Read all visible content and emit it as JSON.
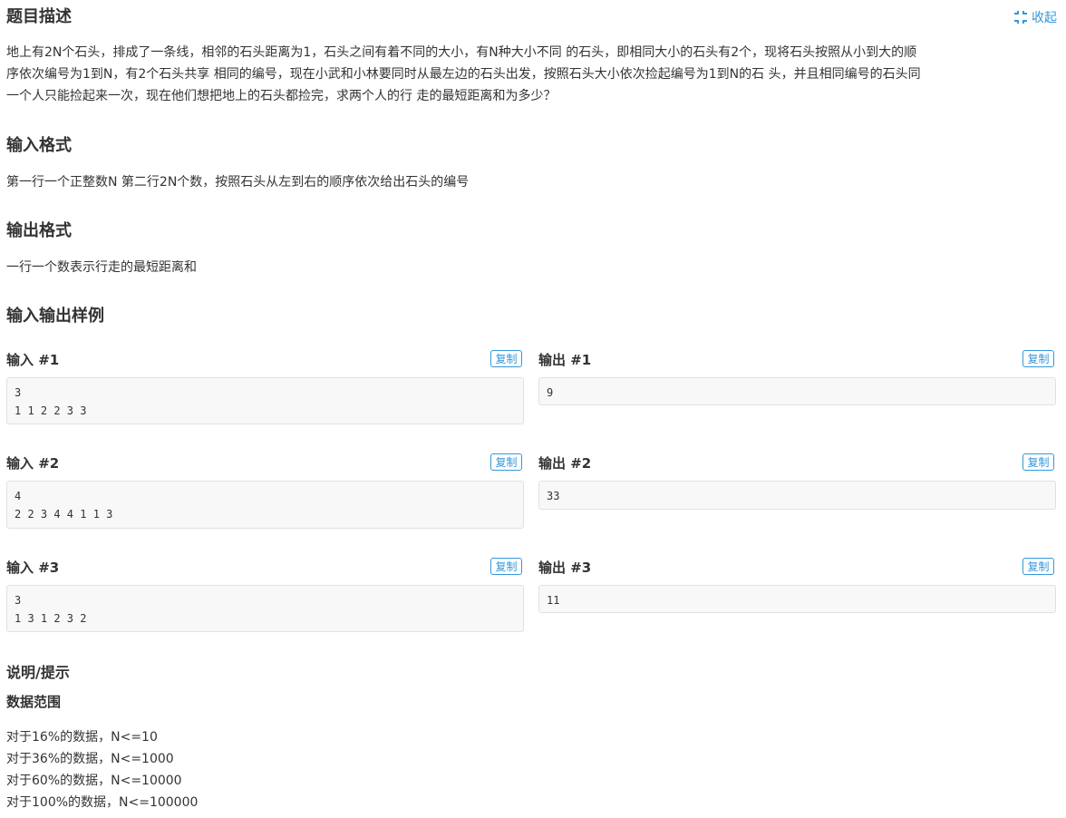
{
  "description": {
    "title": "题目描述",
    "collapse_label": "收起",
    "text": "地上有2N个石头，排成了一条线，相邻的石头距离为1，石头之间有着不同的大小，有N种大小不同 的石头，即相同大小的石头有2个，现将石头按照从小到大的顺\n序依次编号为1到N，有2个石头共享 相同的编号，现在小武和小林要同时从最左边的石头出发，按照石头大小依次捡起编号为1到N的石 头，并且相同编号的石头同\n一个人只能捡起来一次，现在他们想把地上的石头都捡完，求两个人的行 走的最短距离和为多少？"
  },
  "input_format": {
    "title": "输入格式",
    "text": "第一行一个正整数N 第二行2N个数，按照石头从左到右的顺序依次给出石头的编号"
  },
  "output_format": {
    "title": "输出格式",
    "text": "一行一个数表示行走的最短距离和"
  },
  "samples": {
    "title": "输入输出样例",
    "copy_label": "复制",
    "items": [
      {
        "input_title": "输入 #1",
        "input": "3\n1 1 2 2 3 3",
        "output_title": "输出 #1",
        "output": "9"
      },
      {
        "input_title": "输入 #2",
        "input": "4\n2 2 3 4 4 1 1 3",
        "output_title": "输出 #2",
        "output": "33"
      },
      {
        "input_title": "输入 #3",
        "input": "3\n1 3 1 2 3 2",
        "output_title": "输出 #3",
        "output": "11"
      }
    ]
  },
  "hint": {
    "title": "说明/提示",
    "subtitle": "数据范围",
    "ranges": [
      "对于16%的数据，N<=10",
      "对于36%的数据，N<=1000",
      "对于60%的数据，N<=10000",
      "对于100%的数据，N<=100000"
    ]
  },
  "colors": {
    "accent": "#3498db",
    "text": "#333333",
    "code_bg": "#f8f8f8",
    "code_border": "#e1e1e1"
  },
  "icons": {
    "collapse": "collapse-arrows-icon"
  }
}
